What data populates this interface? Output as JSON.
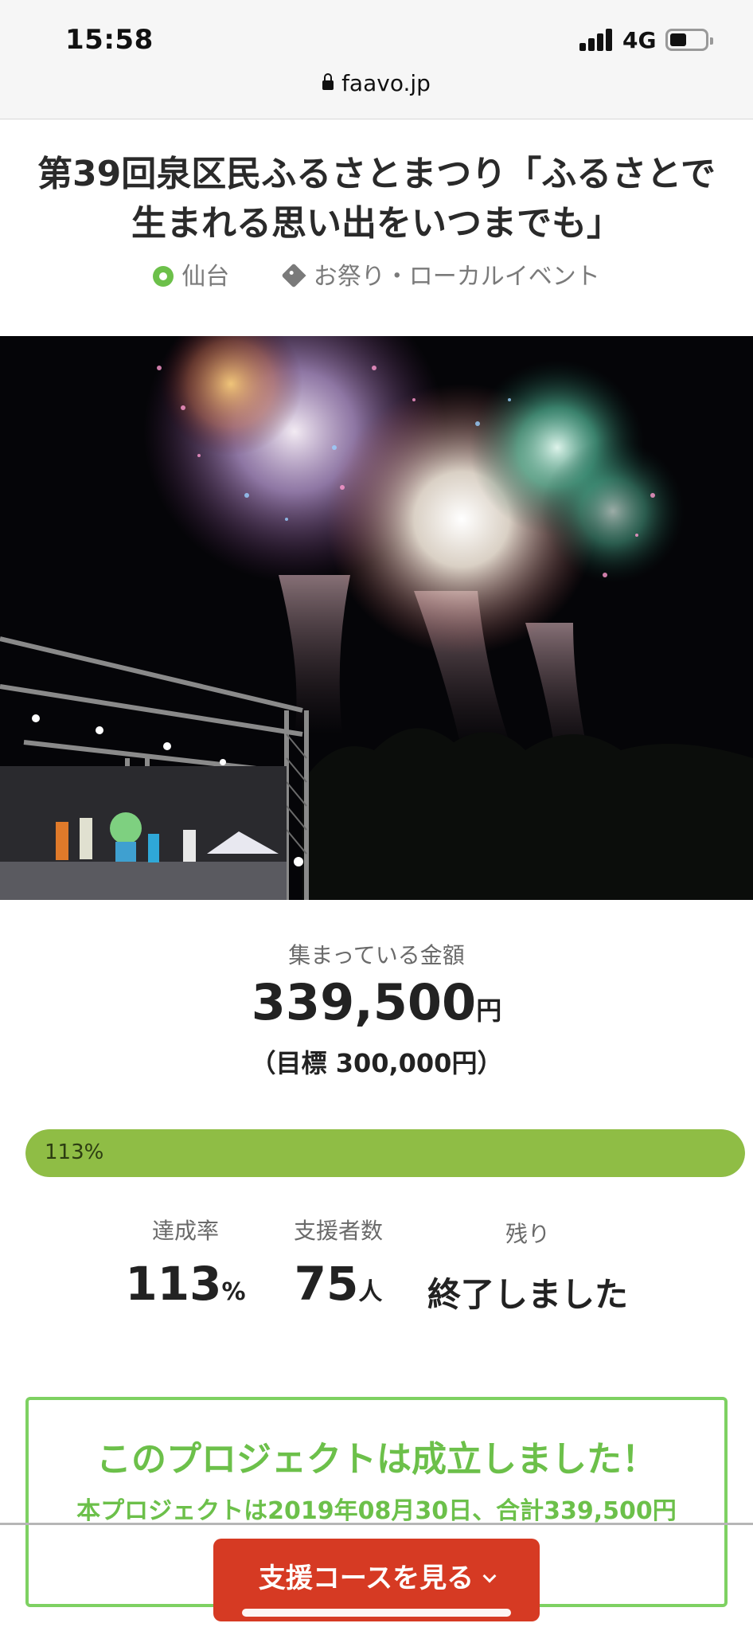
{
  "status_bar": {
    "time": "15:58",
    "network": "4G",
    "battery_level": 0.4
  },
  "browser": {
    "url": "faavo.jp",
    "lock_icon": "lock-icon"
  },
  "project": {
    "title_line1": "第39回泉区民ふるさとまつり「ふるさとで",
    "title_line2": "生まれる思い出をいつまでも」",
    "location": "仙台",
    "category": "お祭り・ローカルイベント",
    "location_icon": "location-dot-icon",
    "category_icon": "tag-icon"
  },
  "funding": {
    "raised_label": "集まっている金額",
    "raised_amount": "339,500",
    "currency": "円",
    "goal": "（目標 300,000円）",
    "progress_label": "113%",
    "progress_fraction": 1.0
  },
  "stats": {
    "rate_label": "達成率",
    "rate_value": "113",
    "rate_unit": "%",
    "backers_label": "支援者数",
    "backers_value": "75",
    "backers_unit": "人",
    "remaining_label": "残り",
    "remaining_value": "終了しました"
  },
  "success": {
    "heading": "このプロジェクトは成立しました！",
    "subtext": "本プロジェクトは2019年08月30日、合計339,500円"
  },
  "cta": {
    "label": "支援コースを見る",
    "icon": "chevron-down-icon"
  },
  "colors": {
    "accent_green": "#6cc04a",
    "progress_green": "#8fbd45",
    "cta_red": "#d63a23"
  }
}
